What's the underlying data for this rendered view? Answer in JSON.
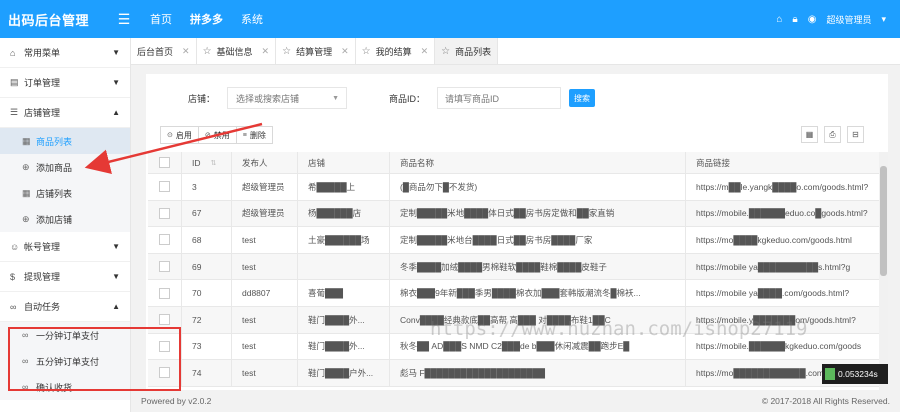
{
  "app": {
    "title": "出码后台管理"
  },
  "topnav": {
    "items": [
      "首页",
      "拼多多",
      "系统"
    ]
  },
  "user": {
    "name": "超级管理员"
  },
  "sidebar": {
    "groups": [
      {
        "label": "常用菜单",
        "icon": "home-icon"
      },
      {
        "label": "订单管理",
        "icon": "order-icon"
      },
      {
        "label": "店铺管理",
        "icon": "list-icon"
      },
      {
        "label": "帐号管理",
        "icon": "user-icon"
      },
      {
        "label": "提现管理",
        "icon": "money-icon"
      },
      {
        "label": "自动任务",
        "icon": "link-icon"
      }
    ],
    "store_subitems": [
      "商品列表",
      "添加商品",
      "店铺列表",
      "添加店铺"
    ],
    "task_subitems": [
      "一分钟订单支付",
      "五分钟订单支付",
      "确认收货"
    ]
  },
  "tabs": [
    "后台首页",
    "基础信息",
    "结算管理",
    "我的结算",
    "商品列表"
  ],
  "filters": {
    "store_label": "店铺：",
    "store_placeholder": "选择或搜索店铺",
    "goods_id_label": "商品ID：",
    "goods_id_placeholder": "请填写商品ID",
    "search_label": "搜索"
  },
  "toolbar": {
    "enable": "启用",
    "disable": "禁用",
    "delete": "删除"
  },
  "table": {
    "columns": [
      "ID",
      "发布人",
      "店铺",
      "商品名称",
      "商品链接"
    ],
    "rows": [
      {
        "id": "3",
        "publisher": "超级管理员",
        "store": "希█████上",
        "name": "(█商品勿下█不发货)",
        "link": "https://m██le.yangk████o.com/goods.html?"
      },
      {
        "id": "67",
        "publisher": "超级管理员",
        "store": "杨██████店",
        "name": "定制█████米地████体日式██房书房定做和██家直销",
        "link": "https://mobile.██████eduo.co█goods.html?"
      },
      {
        "id": "68",
        "publisher": "test",
        "store": "土豪██████场",
        "name": "定制█████米地台████日式██房书房████厂家",
        "link": "https://mo████kgkeduo.com/goods.html"
      },
      {
        "id": "69",
        "publisher": "test",
        "store": "",
        "name": "冬季████加绒████男棉鞋软████鞋棉████皮鞋子",
        "link": "https://mobile ya██████████s.html?g"
      },
      {
        "id": "70",
        "publisher": "dd8807",
        "store": "喜葡███",
        "name": "棉衣███9年新███季男████棉衣加███套韩版潮流冬█棉袄...",
        "link": "https://mobile ya████.com/goods.html?"
      },
      {
        "id": "72",
        "publisher": "test",
        "store": "鞋门████外...",
        "name": "Conv████经典款底██高帮 高███ 对████布鞋1██C",
        "link": "https://mobile.y███████om/goods.html?"
      },
      {
        "id": "73",
        "publisher": "test",
        "store": "鞋门████外...",
        "name": "秋冬██ AD███S NMD C2███de b███休闲减震██跑步E█",
        "link": "https://mobile.██████kgkeduo.com/goods"
      },
      {
        "id": "74",
        "publisher": "test",
        "store": "鞋门████户外...",
        "name": "彪马 F████████████████████",
        "link": "https://mo████████████.com/goods.html?"
      }
    ]
  },
  "footer": {
    "left": "Powered by v2.0.2",
    "right": "© 2017-2018 All Rights Reserved."
  },
  "overlay": {
    "timer": "0.053234s",
    "watermark": "https://www.huzhan.com/ishop27119"
  },
  "colors": {
    "accent": "#1e9fff",
    "annotation": "#e53935"
  }
}
